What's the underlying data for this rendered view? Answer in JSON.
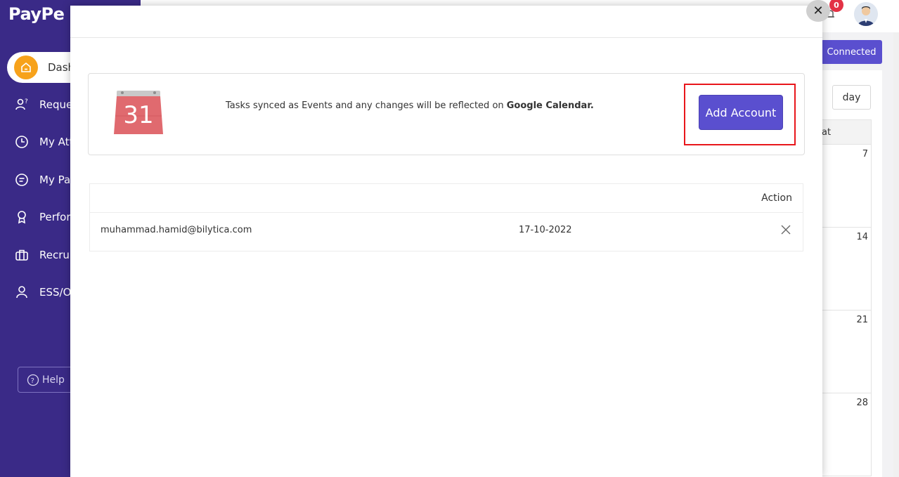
{
  "app": {
    "logo": "PayPe"
  },
  "sidebar": {
    "active_item": "Dash",
    "items": [
      {
        "label": "Reque",
        "icon": "user-question-icon"
      },
      {
        "label": "My Att",
        "icon": "clock-icon"
      },
      {
        "label": "My Pa",
        "icon": "document-icon"
      },
      {
        "label": "Perfor",
        "icon": "award-icon"
      },
      {
        "label": "Recrui",
        "icon": "briefcase-icon"
      },
      {
        "label": "ESS/O",
        "icon": "user-icon"
      }
    ],
    "help_label": "Help"
  },
  "header": {
    "notification_count": "0"
  },
  "background": {
    "connected_label": "Connected",
    "view_day_label": "day",
    "calendar_head": "at",
    "calendar_days": [
      "7",
      "14",
      "21",
      "28"
    ]
  },
  "modal": {
    "sync_text": "Tasks synced as Events and any changes will be reflected on ",
    "sync_text_bold": "Google Calendar.",
    "calendar_icon_day": "31",
    "add_account_label": "Add Account",
    "table": {
      "action_header": "Action",
      "rows": [
        {
          "email": "muhammad.hamid@bilytica.com",
          "date": "17-10-2022"
        }
      ]
    }
  },
  "colors": {
    "sidebar": "#3a2a87",
    "accent": "#5a4fcf",
    "highlight": "#e8161b",
    "badge": "#e33245"
  }
}
